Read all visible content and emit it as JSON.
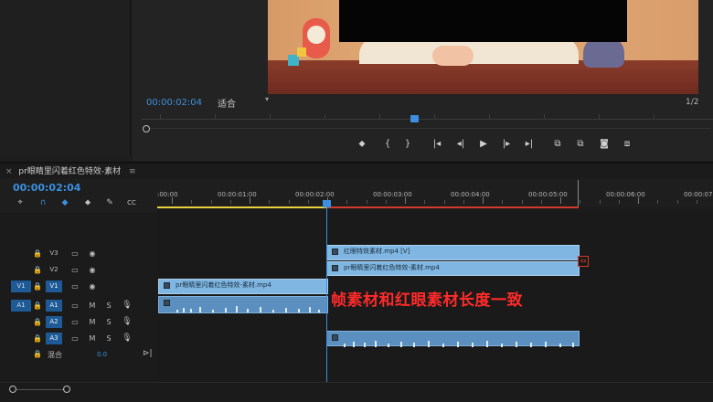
{
  "monitor": {
    "timecode": "00:00:02:04",
    "fit": "适合",
    "fraction": "1/2",
    "transport": {
      "marker": "⬥",
      "in": "{",
      "out": "}",
      "goto_in": "|◂",
      "step_back": "◂|",
      "play": "▶",
      "step_fwd": "|▸",
      "goto_out": "▸|",
      "insert": "⧉",
      "overwrite": "⧉",
      "export_frame": "◙",
      "compare": "⧈"
    }
  },
  "timeline": {
    "tab_close": "×",
    "tab_title": "pr眼睛里闪着红色特效-素材",
    "tab_menu": "≡",
    "timecode": "00:00:02:04",
    "tools": {
      "snap": "⌖",
      "magnet": "∩",
      "linked": "◆",
      "marker": "⬥",
      "wrench": "✎",
      "caption": "CC"
    },
    "ruler_labels": [
      ":00:00",
      "00:00:01:00",
      "00:00:02:00",
      "00:00:03:00",
      "00:00:04:00",
      "00:00:05:00",
      "00:00:06:00",
      "00:00:07"
    ],
    "tracks": [
      {
        "src": "",
        "name": "V3",
        "on": false,
        "lock": "🔒",
        "c1": "▭",
        "c2": "◉",
        "c3": "",
        "c4": ""
      },
      {
        "src": "",
        "name": "V2",
        "on": false,
        "lock": "🔒",
        "c1": "▭",
        "c2": "◉",
        "c3": "",
        "c4": ""
      },
      {
        "src": "V1",
        "name": "V1",
        "on": true,
        "lock": "🔒",
        "c1": "▭",
        "c2": "◉",
        "c3": "",
        "c4": ""
      },
      {
        "src": "A1",
        "name": "A1",
        "on": true,
        "lock": "🔒",
        "c1": "▭",
        "c2": "M",
        "c3": "S",
        "c4": "🎙"
      },
      {
        "src": "",
        "name": "A2",
        "on": true,
        "lock": "🔒",
        "c1": "▭",
        "c2": "M",
        "c3": "S",
        "c4": "🎙"
      },
      {
        "src": "",
        "name": "A3",
        "on": true,
        "lock": "🔒",
        "c1": "▭",
        "c2": "M",
        "c3": "S",
        "c4": "🎙"
      }
    ],
    "mix": {
      "lock": "🔒",
      "label": "混合",
      "value": "0.0",
      "end": "⊳|"
    },
    "clips": {
      "v3": "红眼特效素材.mp4 [V]",
      "v2": "pr眼睛里闪着红色特效-素材.mp4",
      "v1": "pr眼睛里闪着红色特效-素材.mp4",
      "trim_icon": "⇔"
    },
    "annotation": "帧素材和红眼素材长度一致"
  },
  "colors": {
    "accent": "#3b8fde",
    "clip_video": "#7fb7e2",
    "clip_audio": "#5a8fbf",
    "annotation": "#ff2a2a",
    "work_in": "#e8d23c",
    "work_out": "#d23a2e"
  }
}
